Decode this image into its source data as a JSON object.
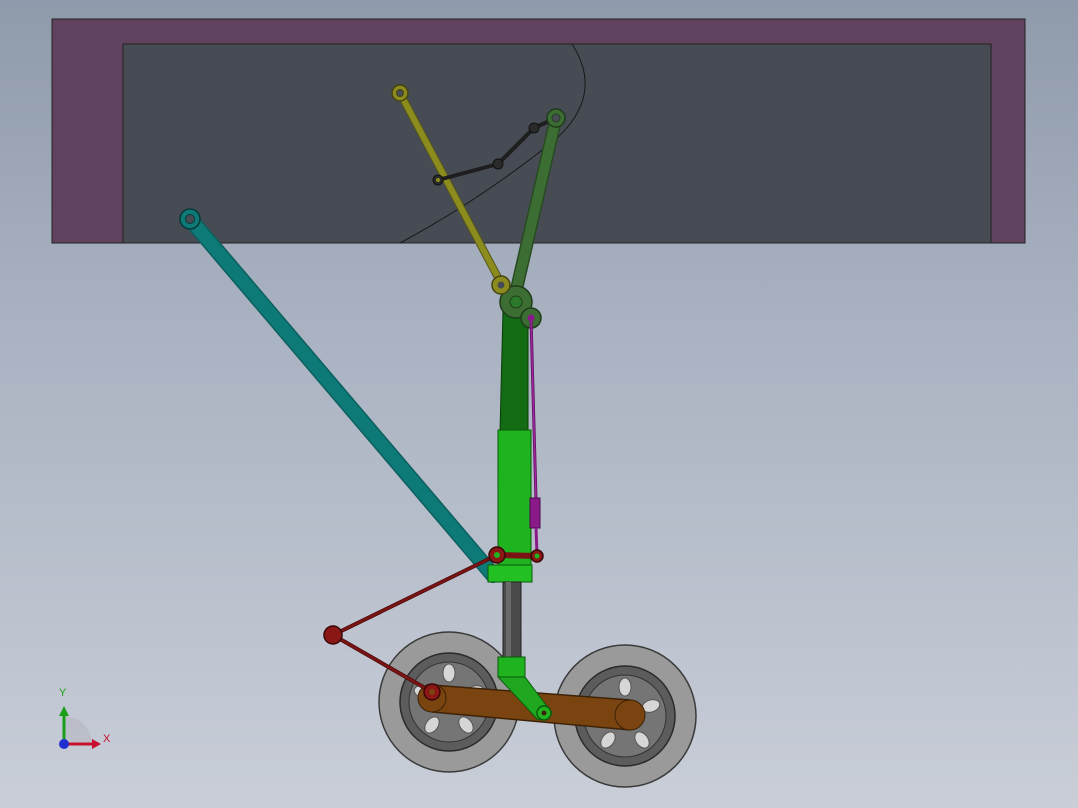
{
  "view": {
    "triad": {
      "x_label": "X",
      "y_label": "Y",
      "x_color": "#c8102e",
      "y_color": "#1a9e1a",
      "z_color": "#1f2fd0"
    }
  },
  "colors": {
    "background_top": "#8f9aab",
    "background_bottom": "#c9ced8",
    "bay_frame": "#60425e",
    "bay_interior": "#474b54",
    "drag_strut": "#0d7a78",
    "upper_link_yellow": "#8c8c1e",
    "upper_link_green": "#3c6e34",
    "main_strut_upper": "#136b13",
    "main_strut_lower": "#1fb31f",
    "piston": "#4a4a4a",
    "actuator": "#8a1a8a",
    "torque_link_red": "#7a1414",
    "bogie_beam": "#7a4410",
    "tire": "#9a9a9a",
    "hub": "#6c6c6c",
    "lock_link": "#1e1e1e"
  }
}
